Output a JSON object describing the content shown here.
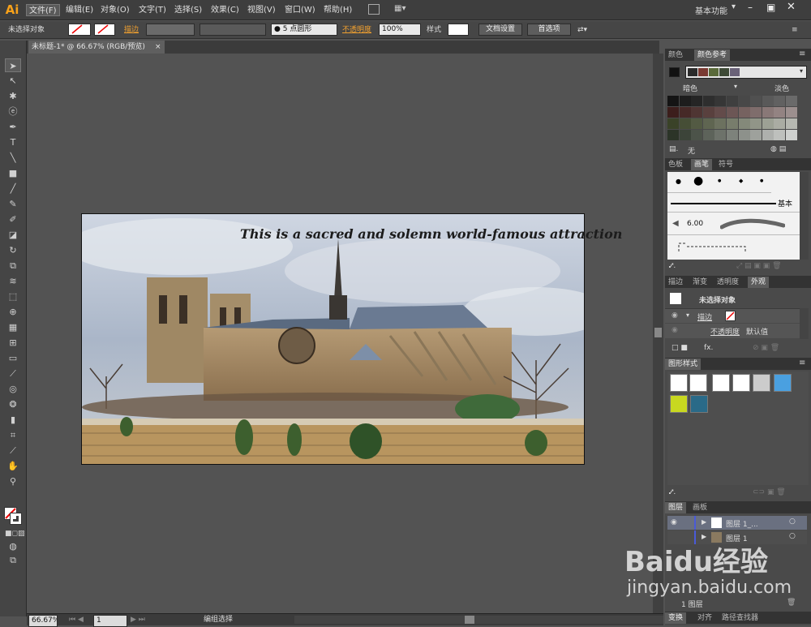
{
  "app": {
    "logo": "Ai",
    "workspace": "基本功能"
  },
  "menus": [
    "文件(F)",
    "编辑(E)",
    "对象(O)",
    "文字(T)",
    "选择(S)",
    "效果(C)",
    "视图(V)",
    "窗口(W)",
    "帮助(H)"
  ],
  "control_bar": {
    "selection_label": "未选择对象",
    "stroke_label": "描边",
    "brush_size": "5",
    "brush_shape": "点圆形",
    "opacity_label": "不透明度",
    "opacity_value": "100%",
    "style_label": "样式",
    "doc_setup": "文档设置",
    "preferences": "首选项"
  },
  "document": {
    "tab_title": "未标题-1* @ 66.67% (RGB/预览)",
    "close": "×"
  },
  "artboard": {
    "caption": "This is a sacred and solemn world-famous attraction"
  },
  "status_bar": {
    "zoom": "66.67%",
    "artboard_num": "1",
    "status_text": "编组选择"
  },
  "color_guide": {
    "tabs": [
      "颜色",
      "颜色参考"
    ],
    "dark_label": "暗色",
    "light_label": "淡色",
    "none_label": "无",
    "harmony_colors": [
      "#2b2b2b",
      "#7a3a32",
      "#5a6a3a",
      "#3e4a36",
      "#6a6278"
    ]
  },
  "brushes": {
    "tabs": [
      "色板",
      "画笔",
      "符号"
    ],
    "basic_label": "基本",
    "brush_size": "6.00"
  },
  "appearance": {
    "tabs": [
      "描边",
      "渐变",
      "透明度",
      "外观"
    ],
    "title": "未选择对象",
    "stroke_label": "描边",
    "opacity_label": "不透明度",
    "opacity_value": "默认值",
    "fx_label": "fx."
  },
  "graphic_styles": {
    "tab": "图形样式"
  },
  "layers": {
    "tabs": [
      "图层",
      "画板"
    ],
    "rows": [
      {
        "name": "图层 1_..."
      },
      {
        "name": "图层 1"
      }
    ],
    "count_label": "1 图层"
  },
  "bottom_panel": {
    "tabs": [
      "变换",
      "对齐",
      "路径查找器"
    ]
  },
  "watermark": {
    "logo": "Baidu经验",
    "url": "jingyan.baidu.com"
  }
}
